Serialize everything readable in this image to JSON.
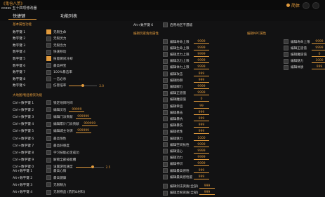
{
  "title": "《鬼谷八荒》",
  "subtitle": "ccess 五十四项修改器",
  "lang": "简体",
  "tabs": [
    {
      "label": "快捷键"
    },
    {
      "label": "功能列表"
    }
  ],
  "colors": {
    "accent": "#e19a3c",
    "bg": "#121213"
  },
  "col1": {
    "section": "基本属性功能",
    "rows": [
      {
        "key": "数字键 1",
        "label": "无限生命",
        "on": true
      },
      {
        "key": "数字键 2",
        "label": "无限灵力",
        "on": false
      },
      {
        "key": "数字键 3",
        "label": "无限念力",
        "on": false
      },
      {
        "key": "数字键 4",
        "label": "快速移动",
        "on": false
      },
      {
        "key": "数字键 5",
        "label": "技能瞬间冷却",
        "on": true
      },
      {
        "key": "数字键 6",
        "label": "最高神宝",
        "on": false
      },
      {
        "key": "数字键 7",
        "label": "100%暴击率",
        "on": false
      },
      {
        "key": "数字键 8",
        "label": "一击必杀",
        "on": false
      },
      {
        "key": "数字键 9",
        "label": "伤害倍率",
        "on": false,
        "slider": "2.0",
        "level": 0.5
      }
    ],
    "section2": "大地图/物品物资功能",
    "rows2": [
      {
        "key": "Ctrl+数字键 1",
        "label": "锁定地目时间"
      },
      {
        "key": "Ctrl+数字键 2",
        "label": "编辑灵石",
        "value": "99999"
      },
      {
        "key": "Ctrl+数字键 3",
        "label": "编辑门派贡献",
        "value": "999999"
      },
      {
        "key": "Ctrl+数字键 4",
        "label": "编辑累计门派贡献",
        "value": "999999"
      },
      {
        "key": "Ctrl+数字键 5",
        "label": "编辑城主令牌",
        "value": "999999"
      },
      {
        "key": "Ctrl+数字键 6",
        "label": "最高悟性"
      },
      {
        "key": "Ctrl+数字键 7",
        "label": "最高好感度"
      },
      {
        "key": "Ctrl+数字键 8",
        "label": "学习技能必定成功"
      },
      {
        "key": "Ctrl+数字键 9",
        "label": "解锁全部技能槽"
      },
      {
        "key": "Ctrl+数字键 0",
        "label": "设置游戏速度",
        "slider": "2.5",
        "level": 0.6
      }
    ],
    "rows3": [
      {
        "key": "Alt+数字键 1",
        "label": "最高心情"
      },
      {
        "key": "Alt+数字键 2",
        "label": "最高健康"
      },
      {
        "key": "Alt+数字键 3",
        "label": "无限精力"
      },
      {
        "key": "Alt+数字键 4",
        "label": "无限物品 (药药&材料)"
      }
    ]
  },
  "col2": {
    "top_key": "Alt+数字键 6",
    "top_label": "启用地区不遇敌",
    "section": "编辑玩家角色属性",
    "rows": [
      {
        "label": "编辑寿命上限",
        "value": "9999"
      },
      {
        "label": "编辑生命上限",
        "value": "9999"
      },
      {
        "label": "编辑灵力上限",
        "value": "9999"
      },
      {
        "label": "编辑念力上限",
        "value": "9999"
      },
      {
        "label": "编辑体力上限",
        "value": "9999"
      },
      {
        "label": "编辑攻击",
        "value": "999"
      },
      {
        "label": "编辑防御",
        "value": "999"
      },
      {
        "label": "编辑脚力",
        "value": "9999"
      },
      {
        "label": "编辑正道值",
        "value": "9999"
      },
      {
        "label": "编辑魔道值",
        "value": "0"
      },
      {
        "label": "编辑幸运",
        "value": "99"
      },
      {
        "label": "编辑暴击",
        "value": "999"
      },
      {
        "label": "编辑暴抗",
        "value": "999"
      },
      {
        "label": "编辑暴伤",
        "value": "999"
      },
      {
        "label": "编辑抗性",
        "value": "999"
      },
      {
        "label": "编辑魅力",
        "value": "1000"
      },
      {
        "label": "编辑空间抗性",
        "value": "9999"
      },
      {
        "label": "编辑道心",
        "value": "9999"
      },
      {
        "label": "编辑功力",
        "value": "9999"
      },
      {
        "label": "编辑神识",
        "value": "9999"
      },
      {
        "label": "编辑最高感悟",
        "value": "999"
      },
      {
        "label": "编辑最高感悟度",
        "value": "999"
      }
    ],
    "bottom": [
      {
        "label": "编辑剑法资质(全部)",
        "value": "999"
      },
      {
        "label": "编辑灵根资质(全部)",
        "value": "999"
      }
    ]
  },
  "col3": {
    "section": "编辑NPC属性",
    "rows": [
      {
        "label": "编辑寿命上限",
        "value": "9999"
      },
      {
        "label": "编辑正道值",
        "value": "9999"
      },
      {
        "label": "编辑魔道值",
        "value": "0"
      },
      {
        "label": "编辑魅力",
        "value": "1000"
      },
      {
        "label": "编辑体质",
        "value": "999"
      }
    ]
  }
}
